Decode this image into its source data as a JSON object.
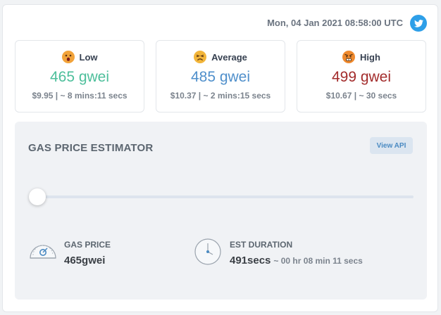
{
  "header": {
    "datetime": "Mon, 04 Jan 2021 08:58:00 UTC",
    "share_icon": "twitter-icon"
  },
  "tiers": [
    {
      "name": "Low",
      "emoji": "surprised-face-icon",
      "price": "465 gwei",
      "meta": "$9.95 | ~ 8 mins:11 secs",
      "color": "#4dbf9b"
    },
    {
      "name": "Average",
      "emoji": "persevering-face-icon",
      "price": "485 gwei",
      "meta": "$10.37 | ~ 2 mins:15 secs",
      "color": "#4f8fcb"
    },
    {
      "name": "High",
      "emoji": "angry-face-icon",
      "price": "499 gwei",
      "meta": "$10.67 | ~ 30 secs",
      "color": "#a32c2c"
    }
  ],
  "estimator": {
    "title": "GAS PRICE ESTIMATOR",
    "view_api_label": "View API",
    "slider_value": 0.0,
    "gas_price": {
      "label": "GAS PRICE",
      "value": "465gwei",
      "icon": "gauge-icon"
    },
    "duration": {
      "label": "EST DURATION",
      "value": "491secs",
      "detail": "~ 00 hr 08 min 11 secs",
      "icon": "clock-icon"
    }
  }
}
